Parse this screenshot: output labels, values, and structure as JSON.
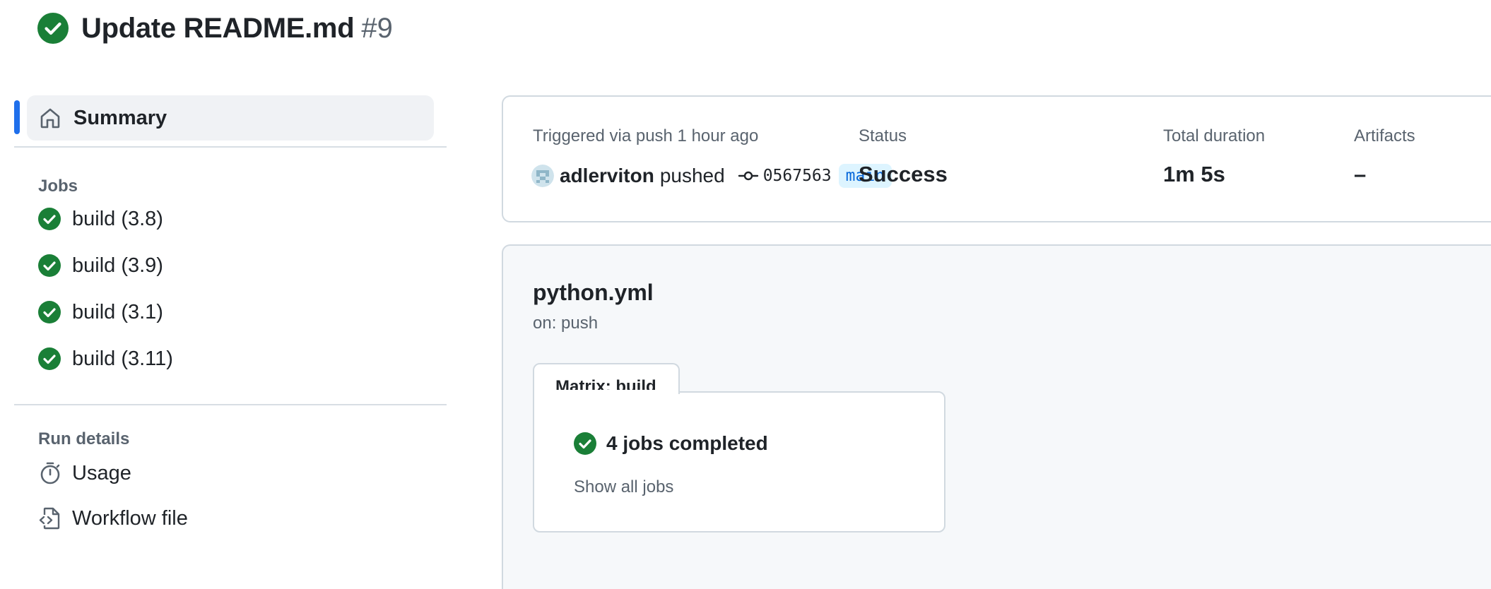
{
  "header": {
    "title": "Update README.md",
    "run_number": "#9",
    "status_icon": "check-circle-fill-icon"
  },
  "sidebar": {
    "summary_label": "Summary",
    "jobs_heading": "Jobs",
    "jobs": [
      {
        "label": "build (3.8)",
        "status": "success"
      },
      {
        "label": "build (3.9)",
        "status": "success"
      },
      {
        "label": "build (3.1)",
        "status": "success"
      },
      {
        "label": "build (3.11)",
        "status": "success"
      }
    ],
    "run_details_heading": "Run details",
    "run_details": [
      {
        "label": "Usage",
        "icon": "stopwatch-icon"
      },
      {
        "label": "Workflow file",
        "icon": "file-code-icon"
      }
    ]
  },
  "info": {
    "triggered": "Triggered via push 1 hour ago",
    "actor": "adlerviton",
    "action": "pushed",
    "commit_sha": "0567563",
    "branch": "main",
    "status_label": "Status",
    "status_value": "Success",
    "duration_label": "Total duration",
    "duration_value": "1m 5s",
    "artifacts_label": "Artifacts",
    "artifacts_value": "–"
  },
  "workflow": {
    "name": "python.yml",
    "event": "on: push",
    "matrix_label": "Matrix: build",
    "completed_label": "4 jobs completed",
    "show_all_label": "Show all jobs"
  },
  "colors": {
    "success": "#1a7f37",
    "accent": "#1f6feb",
    "branch_bg": "#ddf4ff",
    "branch_fg": "#0969da"
  }
}
